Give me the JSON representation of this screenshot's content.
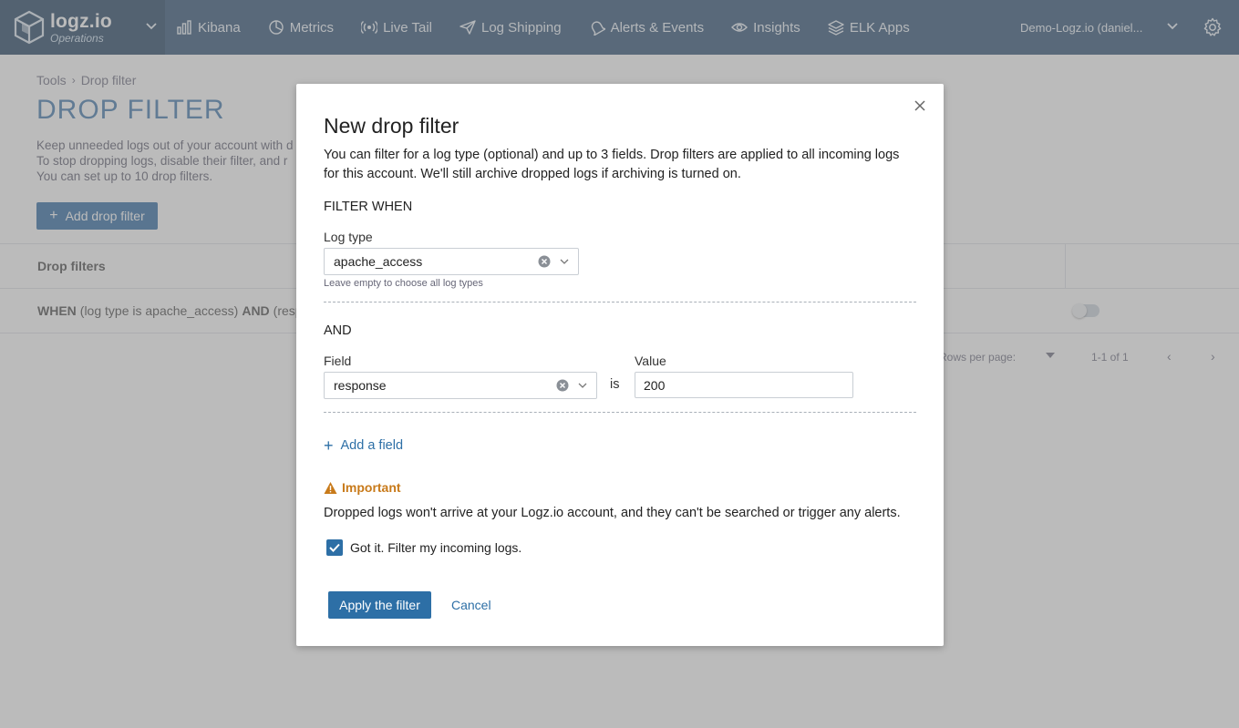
{
  "brand": {
    "name": "logz.io",
    "subtitle": "Operations"
  },
  "nav": {
    "items": [
      {
        "label": "Kibana",
        "icon": "bar-chart-icon"
      },
      {
        "label": "Metrics",
        "icon": "pie-chart-icon"
      },
      {
        "label": "Live Tail",
        "icon": "broadcast-icon"
      },
      {
        "label": "Log Shipping",
        "icon": "paper-plane-icon"
      },
      {
        "label": "Alerts & Events",
        "icon": "bell-icon"
      },
      {
        "label": "Insights",
        "icon": "eye-icon"
      },
      {
        "label": "ELK Apps",
        "icon": "layers-icon"
      }
    ],
    "account": "Demo-Logz.io (daniel..."
  },
  "page": {
    "breadcrumb": [
      "Tools",
      "Drop filter"
    ],
    "title": "DROP FILTER",
    "desc_lines": [
      "Keep unneeded logs out of your account with d",
      "To stop dropping logs, disable their filter, and r",
      "You can set up to 10 drop filters."
    ],
    "add_button": "Add drop filter",
    "table": {
      "header": "Drop filters",
      "row_when": "WHEN",
      "row_text1": "(log type is apache_access)",
      "row_and": "AND",
      "row_text2": "(resp"
    },
    "pager": {
      "rows_label": "Rows per page:",
      "range": "1-1 of 1"
    }
  },
  "modal": {
    "title": "New drop filter",
    "description": "You can filter for a log type (optional) and up to 3 fields. Drop filters are applied to all incoming logs for this account. We'll still archive dropped logs if archiving is turned on.",
    "filter_when": "FILTER WHEN",
    "log_type_label": "Log type",
    "log_type_value": "apache_access",
    "log_type_hint": "Leave empty to choose all log types",
    "and_label": "AND",
    "field_label": "Field",
    "field_value": "response",
    "is_label": "is",
    "value_label": "Value",
    "value_value": "200",
    "add_field": "Add a field",
    "important": "Important",
    "warning": "Dropped logs won't arrive at your Logz.io account, and they can't be searched or trigger any alerts.",
    "checkbox_label": "Got it. Filter my incoming logs.",
    "checkbox_checked": true,
    "apply": "Apply the filter",
    "cancel": "Cancel"
  },
  "colors": {
    "nav_bg": "#3a5a7c",
    "accent": "#2d6fa6",
    "warning": "#c87a1a"
  }
}
